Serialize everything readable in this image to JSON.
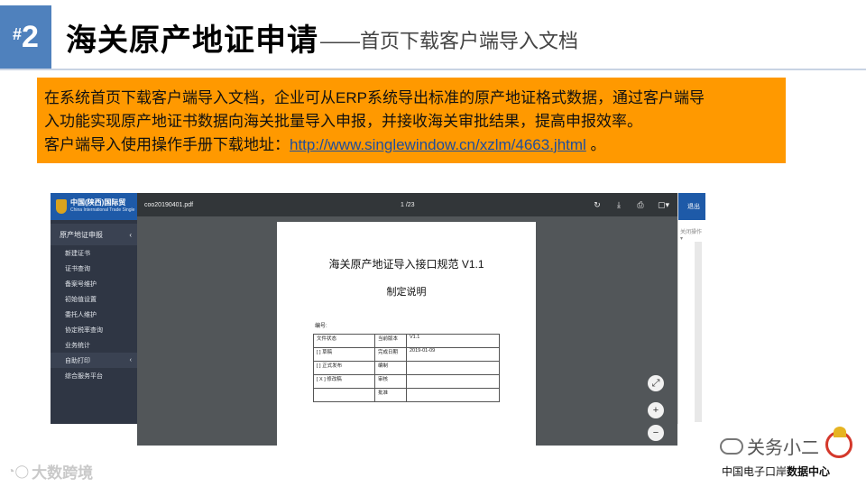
{
  "slide": {
    "hash": "#",
    "number": "2",
    "title": "海关原产地证申请",
    "subtitle": "——首页下载客户端导入文档"
  },
  "info": {
    "line1": "在系统首页下载客户端导入文档，企业可从ERP系统导出标准的原产地证格式数据，通过客户端导",
    "line2": "入功能实现原产地证书数据向海关批量导入申报，并接收海关审批结果，提高申报效率。",
    "line3_prefix": "客户端导入使用操作手册下载地址：",
    "link": "http://www.singlewindow.cn/xzlm/4663.jhtml",
    "line3_suffix": " 。"
  },
  "app": {
    "logo_title": "中国(陕西)国际贸",
    "logo_sub": "China International Trade Single",
    "menu_group": "原产地证申报",
    "menu_items": [
      "新建证书",
      "证书查询",
      "备案号维护",
      "初始值设置",
      "委托人维护",
      "协定税率查询",
      "业务统计"
    ],
    "menu_group2": "自助打印",
    "menu_item_last": "综合服务平台",
    "exit_label": "退出",
    "close_op": "关闭操作 ▾"
  },
  "viewer": {
    "filename": "coo20190401.pdf",
    "pager": "1 /23",
    "doc_title": "海关原产地证导入接口规范 V1.1",
    "doc_subtitle": "制定说明",
    "doc_num_label": "编号:",
    "table": {
      "r1": [
        "文件状态",
        "当前版本",
        "V1.1"
      ],
      "r2": [
        "[ ] 草稿",
        "完成日期",
        "2019-01-09"
      ],
      "r3": [
        "[ ] 正式发布",
        "编制",
        ""
      ],
      "r4": [
        "[ X ] 修改稿",
        "审核",
        ""
      ],
      "r5": [
        "",
        "批准",
        ""
      ]
    }
  },
  "watermark_left": "大数跨境",
  "brand_right": "关务小二",
  "org_right_a": "中国电子口岸",
  "org_right_b": "数据中心"
}
